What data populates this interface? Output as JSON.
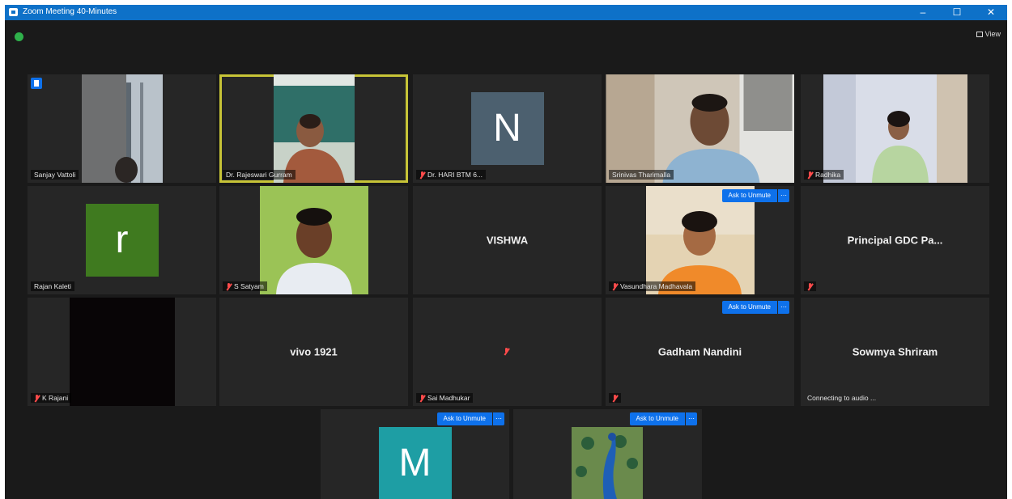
{
  "window": {
    "title": "Zoom Meeting 40-Minutes",
    "minimize": "–",
    "maximize": "☐",
    "close": "✕"
  },
  "topbar": {
    "view_label": "View"
  },
  "participants": [
    {
      "name": "Sanjay Vattoli"
    },
    {
      "name": "Dr. Rajeswari Gurram"
    },
    {
      "name": "Dr. HARI BTM 6...",
      "initial": "N"
    },
    {
      "name": "Srinivas Tharimalla"
    },
    {
      "name": "Radhika"
    },
    {
      "name": "Rajan Kaleti",
      "initial": "r"
    },
    {
      "name": "S Satyam"
    },
    {
      "name": "",
      "center": "VISHWA"
    },
    {
      "name": "Vasundhara Madhavala",
      "unmute": "Ask to Unmute"
    },
    {
      "name": "",
      "center": "Principal GDC Pa..."
    },
    {
      "name": "K Rajani"
    },
    {
      "name": "",
      "center": "vivo 1921"
    },
    {
      "name": "Sai Madhukar",
      "center": ""
    },
    {
      "name": "",
      "center": "Gadham Nandini",
      "unmute": "Ask to Unmute"
    },
    {
      "name": "Connecting to audio ...",
      "center": "Sowmya Shriram"
    },
    {
      "name": "",
      "initial": "M",
      "unmute": "Ask to Unmute"
    },
    {
      "name": "",
      "unmute": "Ask to Unmute"
    }
  ],
  "colors": {
    "titlebar": "#0e71c8",
    "active_border": "#c7c437",
    "avatar_N": "#4c606f",
    "avatar_r": "#3f7a1f",
    "avatar_M": "#1e9ea4"
  }
}
